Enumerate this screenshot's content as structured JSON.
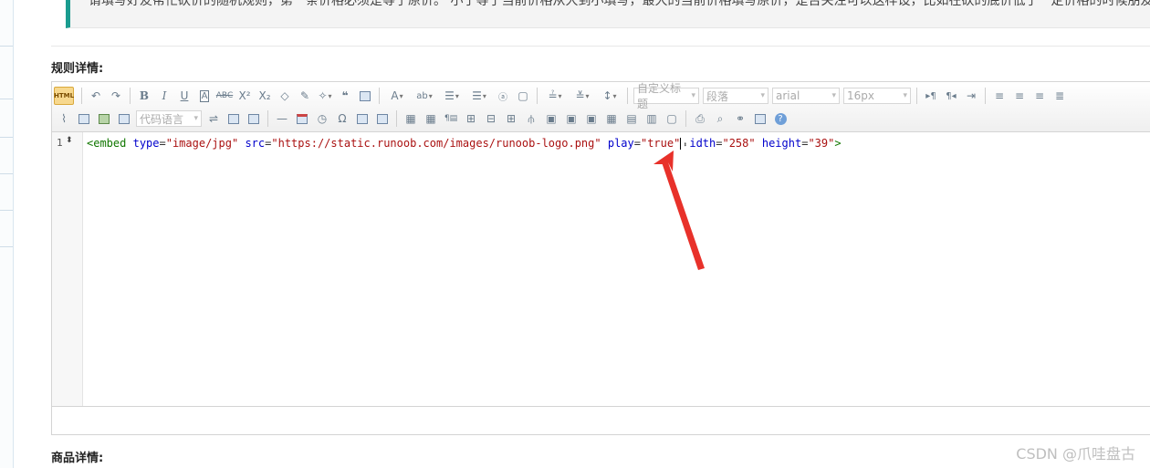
{
  "note": {
    "text": "请填写好友帮忙砍价的随机规则，第一条价格必须是等于原价。 小于等于当前价格从大到小填写，最大的当前价格填写原价，是否关注可以这样设，比如在砍的底价低于一定价格的时候朋友必须关注"
  },
  "sections": {
    "rules_label": "规则详情:",
    "goods_label": "商品详情:"
  },
  "toolbar": {
    "html_label": "HTML",
    "custom_title": "自定义标题",
    "paragraph": "段落",
    "font_family": "arial",
    "font_size": "16px",
    "code_lang": "代码语言",
    "row1_icons": [
      "undo-icon",
      "redo-icon",
      "bold-icon",
      "italic-icon",
      "underline-icon",
      "font-border-icon",
      "strikethrough-icon",
      "superscript-icon",
      "subscript-icon",
      "eraser-icon",
      "format-brush-icon",
      "auto-typeset-icon",
      "blockquote-icon",
      "paste-plain-icon",
      "font-color-icon",
      "highlight-color-icon",
      "ordered-list-icon",
      "unordered-list-icon",
      "select-all-icon",
      "clear-doc-icon",
      "row-spacing-top-icon",
      "row-spacing-bottom-icon",
      "line-height-icon"
    ],
    "row1_right_icons": [
      "ltr-icon",
      "rtl-icon",
      "indent-icon",
      "align-left-icon",
      "align-center-icon",
      "align-right-icon",
      "align-justify-icon"
    ],
    "row2_icons": [
      "attachment-icon",
      "image-icon",
      "insert-image-icon",
      "emotion-icon",
      "page-break-icon",
      "anchor-icon",
      "map-icon",
      "horizontal-rule-icon",
      "date-icon",
      "time-icon",
      "special-chars-icon",
      "background-icon",
      "chart-icon",
      "insert-table-icon",
      "delete-table-icon",
      "insert-paragraph-before-table-icon",
      "insert-row-icon",
      "delete-row-icon",
      "insert-col-icon",
      "delete-col-icon",
      "merge-cells-icon",
      "merge-right-icon",
      "merge-down-icon",
      "split-to-cells-icon",
      "split-to-rows-icon",
      "split-to-cols-icon",
      "print-icon",
      "preview-icon",
      "search-replace-icon",
      "drafts-icon",
      "help-icon"
    ]
  },
  "editor": {
    "line_number": "1",
    "code": {
      "tag_open": "<embed",
      "attr_type": "type",
      "val_type": "\"image/jpg\"",
      "attr_src": "src",
      "val_src": "\"https://static.runoob.com/images/runoob-logo.png\"",
      "attr_play": "play",
      "val_play": "\"true\"",
      "attr_width_tail": "idth",
      "val_width": "\"258\"",
      "attr_height": "height",
      "val_height": "\"39\"",
      "tag_close": ">"
    }
  },
  "watermark": "CSDN @爪哇盘古",
  "colors": {
    "accent": "#1a9c8f",
    "annotation_arrow": "#e8312a"
  }
}
